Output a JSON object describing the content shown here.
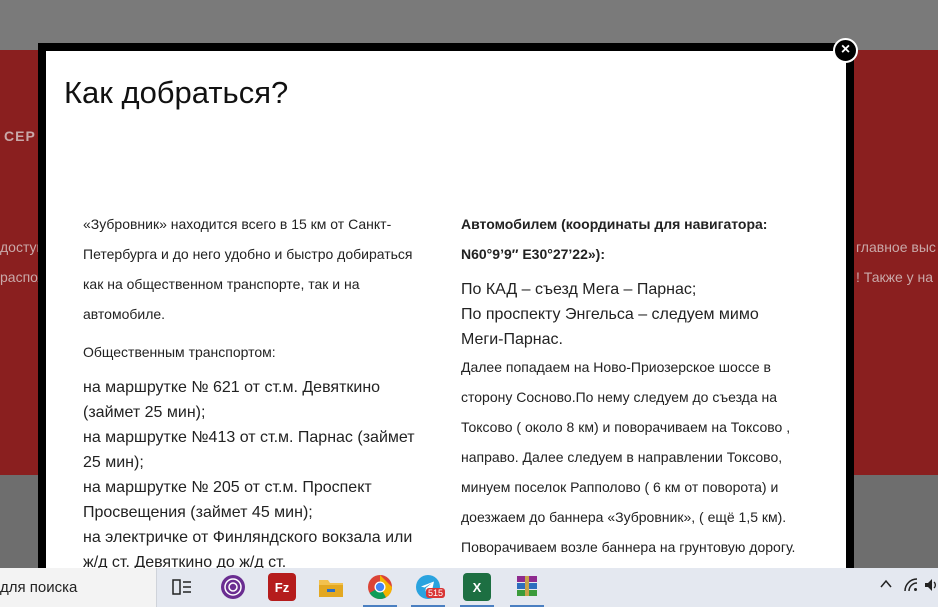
{
  "background": {
    "section_label": "СЕР",
    "left_line1": "доступ",
    "left_line2": "распола",
    "right_line1": "главное выс",
    "right_line2": "! Также у на"
  },
  "modal": {
    "title": "Как добраться?",
    "close_label": "×",
    "left": {
      "intro": "«Зубровник» находится всего в 15 км от Санкт-Петербурга и до него удобно и быстро добираться как на общественном транспорте, так и на автомобиле.",
      "transport_heading": "Общественным транспортом:",
      "routes": [
        "на маршрутке № 621 от ст.м. Девяткино (займет 25 мин);",
        "на маршрутке №413 от ст.м. Парнас (займет 25 мин);",
        "на маршрутке № 205 от ст.м. Проспект Просвещения (займет 45 мин);",
        "на электричке от Финляндского вокзала или ж/д ст. Девяткино до ж/д ст."
      ]
    },
    "right": {
      "car_heading": "Автомобилем (координаты для навигатора: N60°9’9″ E30°27’22»):",
      "lines": [
        "По КАД – съезд Мега – Парнас;",
        "По проспекту Энгельса – следуем мимо Меги-Парнас."
      ],
      "directions": "Далее попадаем на Ново-Приозерское шоссе в сторону Сосново.По нему следуем до съезда на Токсово ( около 8 км) и поворачиваем на Токсово , направо. Далее следуем в направлении Токсово, минуем поселок Рапполово ( 6 км от поворота) и доезжаем до баннера «Зубровник», ( ещё 1,5 км). Поворачиваем возле баннера на грунтовую дорогу."
    }
  },
  "taskbar": {
    "search_text": "для поиска",
    "telegram_badge": "515",
    "filezilla_label": "Fz",
    "excel_label": "X",
    "apps": [
      "task-view",
      "tor-browser",
      "filezilla",
      "file-explorer",
      "chrome",
      "telegram",
      "excel",
      "winrar"
    ]
  }
}
